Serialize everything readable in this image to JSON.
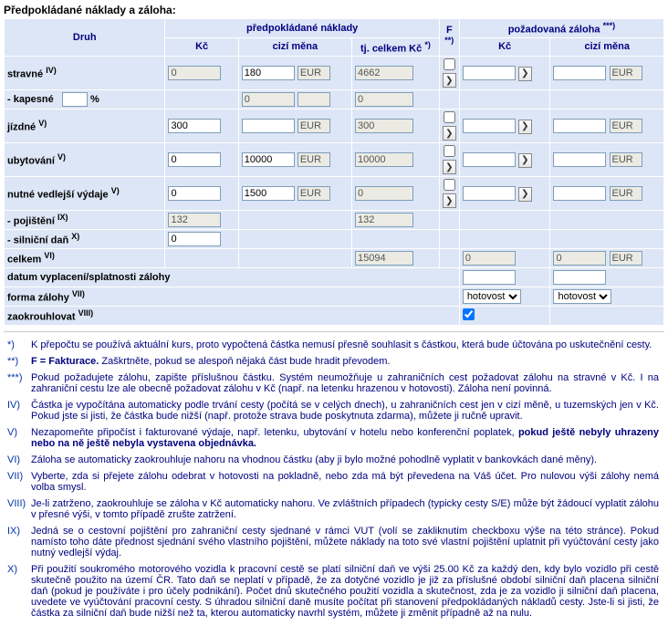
{
  "title": "Předpokládané náklady a záloha:",
  "headers": {
    "druh": "Druh",
    "predp_top": "předpokládané náklady",
    "kc": "Kč",
    "cizi": "cizí měna",
    "tjcelkem": "tj. celkem Kč",
    "tjcelkem_sup": "*)",
    "f": "F",
    "f_sup": "**)",
    "pozadovana": "požadovaná záloha",
    "pozadovana_sup": "***)"
  },
  "rows": {
    "stravne": {
      "label": "stravné",
      "sup": "IV)",
      "kc": "0",
      "cm": "180",
      "cur": "EUR",
      "tot": "4662",
      "z_kc": "",
      "z_cm": "",
      "z_cur": "EUR"
    },
    "kapesne": {
      "label": " - kapesné",
      "pct": "",
      "unit": "%",
      "cm": "0",
      "cur": "",
      "tot": "0"
    },
    "jizdne": {
      "label": "jízdné",
      "sup": "V)",
      "kc": "300",
      "cm": "",
      "cur": "EUR",
      "tot": "300",
      "z_kc": "",
      "z_cm": "",
      "z_cur": "EUR"
    },
    "ubytovani": {
      "label": "ubytování",
      "sup": "V)",
      "kc": "0",
      "cm": "10000",
      "cur": "EUR",
      "tot": "10000",
      "z_kc": "",
      "z_cm": "",
      "z_cur": "EUR"
    },
    "nutne": {
      "label": "nutné vedlejší výdaje",
      "sup": "V)",
      "kc": "0",
      "cm": "1500",
      "cur": "EUR",
      "tot": "0",
      "z_kc": "",
      "z_cm": "",
      "z_cur": "EUR"
    },
    "pojisteni": {
      "label": " - pojištění",
      "sup": "IX)",
      "kc": "132",
      "tot": "132"
    },
    "silnicni": {
      "label": " - silniční daň",
      "sup": "X)",
      "kc": "0"
    },
    "celkem": {
      "label": "celkem",
      "sup": "VI)",
      "tot": "15094",
      "z_kc": "0",
      "z_cm": "0",
      "z_cur": "EUR"
    },
    "datum": {
      "label": "datum vyplacení/splatnosti zálohy"
    },
    "forma": {
      "label": "forma zálohy",
      "sup": "VII)",
      "sel": "hotovost"
    },
    "zaokr": {
      "label": "zaokrouhlovat",
      "sup": "VIII)",
      "chk": true
    }
  },
  "glyph_right": "❯",
  "notes": [
    {
      "m": "*)",
      "t": "K přepočtu se používá aktuální kurs, proto vypočtená částka nemusí přesně souhlasit s částkou, která bude účtována po uskutečnění cesty."
    },
    {
      "m": "**)",
      "t": "<b>F = Fakturace.</b> Zaškrtněte, pokud se alespoň nějaká část bude hradit převodem."
    },
    {
      "m": "***)",
      "t": "Pokud požadujete zálohu, zapište příslušnou částku. Systém neumožňuje u zahraničních cest požadovat zálohu na stravné v Kč. I na zahraniční cestu lze ale obecně požadovat zálohu v Kč (např. na letenku hrazenou v hotovosti). Záloha není povinná."
    },
    {
      "m": "IV)",
      "t": "Částka je vypočítána automaticky podle trvání cesty (počítá se v celých dnech), u zahraničních cest jen v cizí měně, u tuzemských jen v Kč. Pokud jste si jisti, že částka bude nižší (např. protože strava bude poskytnuta zdarma), můžete ji ručně upravit."
    },
    {
      "m": "V)",
      "t": "Nezapomeňte připočíst i fakturované výdaje, např. letenku, ubytování v hotelu nebo konferenční poplatek, <b>pokud ještě nebyly uhrazeny nebo na ně ještě nebyla vystavena objednávka.</b>"
    },
    {
      "m": "VI)",
      "t": "Záloha se automaticky zaokrouhluje nahoru na vhodnou částku (aby ji bylo možné pohodlně vyplatit v bankovkách dané měny)."
    },
    {
      "m": "VII)",
      "t": "Vyberte, zda si přejete zálohu odebrat v hotovosti na pokladně, nebo zda má být převedena na Váš účet. Pro nulovou výši zálohy nemá volba smysl."
    },
    {
      "m": "VIII)",
      "t": "Je-li zatrženo, zaokrouhluje se záloha v Kč automaticky nahoru. Ve zvláštních případech (typicky cesty S/E) může být žádoucí vyplatit zálohu v přesné výši, v tomto případě zrušte zatržení."
    },
    {
      "m": "IX)",
      "t": "Jedná se o cestovní pojištění pro zahraniční cesty sjednané v rámci VUT (volí se zakliknutím checkboxu výše na této stránce). Pokud namísto toho dáte přednost sjednání svého vlastního pojištění, můžete náklady na toto své vlastní pojištění uplatnit při vyúčtování cesty jako nutný vedlejší výdaj."
    },
    {
      "m": "X)",
      "t": "Při použití soukromého motorového vozidla k pracovní cestě se platí silniční daň ve výši 25.00 Kč za každý den, kdy bylo vozidlo při cestě skutečně použito na území ČR. Tato daň se neplatí v případě, že za dotyčné vozidlo je již za příslušné období silniční daň placena silniční daň (pokud je používáte i pro účely podnikání). Počet dnů skutečného použití vozidla a skutečnost, zda je za vozidlo ji silniční daň placena, uvedete ve vyúčtování pracovní cesty. S úhradou silniční daně musíte počítat při stanovení předpokládaných nákladů cesty. Jste-li si jisti, že částka za silniční daň bude nižší než ta, kterou automaticky navrhl systém, můžete ji změnit případně až na nulu."
    }
  ]
}
